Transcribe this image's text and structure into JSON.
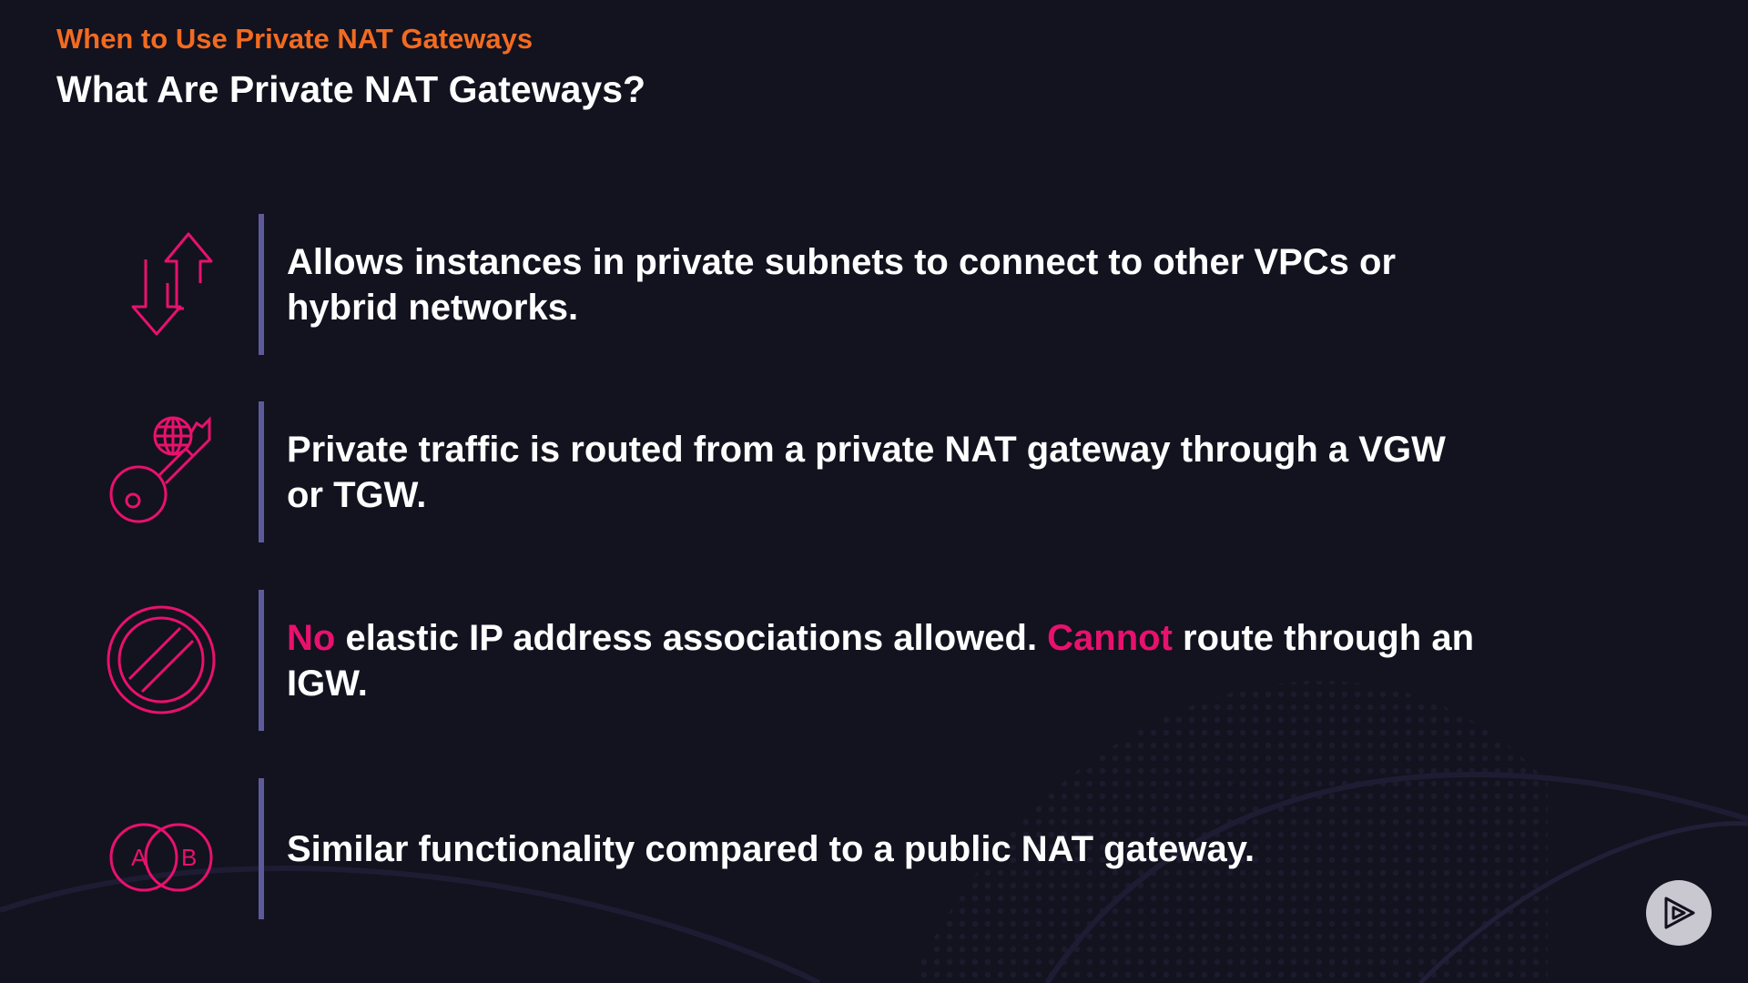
{
  "slide": {
    "section_title": "When to Use Private NAT Gateways",
    "title": "What Are Private NAT Gateways?"
  },
  "points": [
    {
      "icon": "up-down-arrows-icon",
      "text": "Allows instances in private subnets to connect to other VPCs or hybrid networks."
    },
    {
      "icon": "globe-key-icon",
      "text": "Private traffic is routed from a private NAT gateway through a VGW or TGW."
    },
    {
      "icon": "prohibited-icon",
      "highlight_1": "No",
      "text_1": " elastic IP address associations allowed. ",
      "highlight_2": "Cannot",
      "text_2": " route through an IGW."
    },
    {
      "icon": "venn-ab-icon",
      "venn_left": "A",
      "venn_right": "B",
      "text": "Similar functionality compared to a public NAT gateway."
    }
  ],
  "colors": {
    "background": "#13121f",
    "accent_orange": "#f26b21",
    "accent_pink": "#e8116e",
    "divider": "#5d5a9c",
    "text": "#ffffff"
  },
  "controls": {
    "play_icon": "pluralsight-play-icon"
  }
}
